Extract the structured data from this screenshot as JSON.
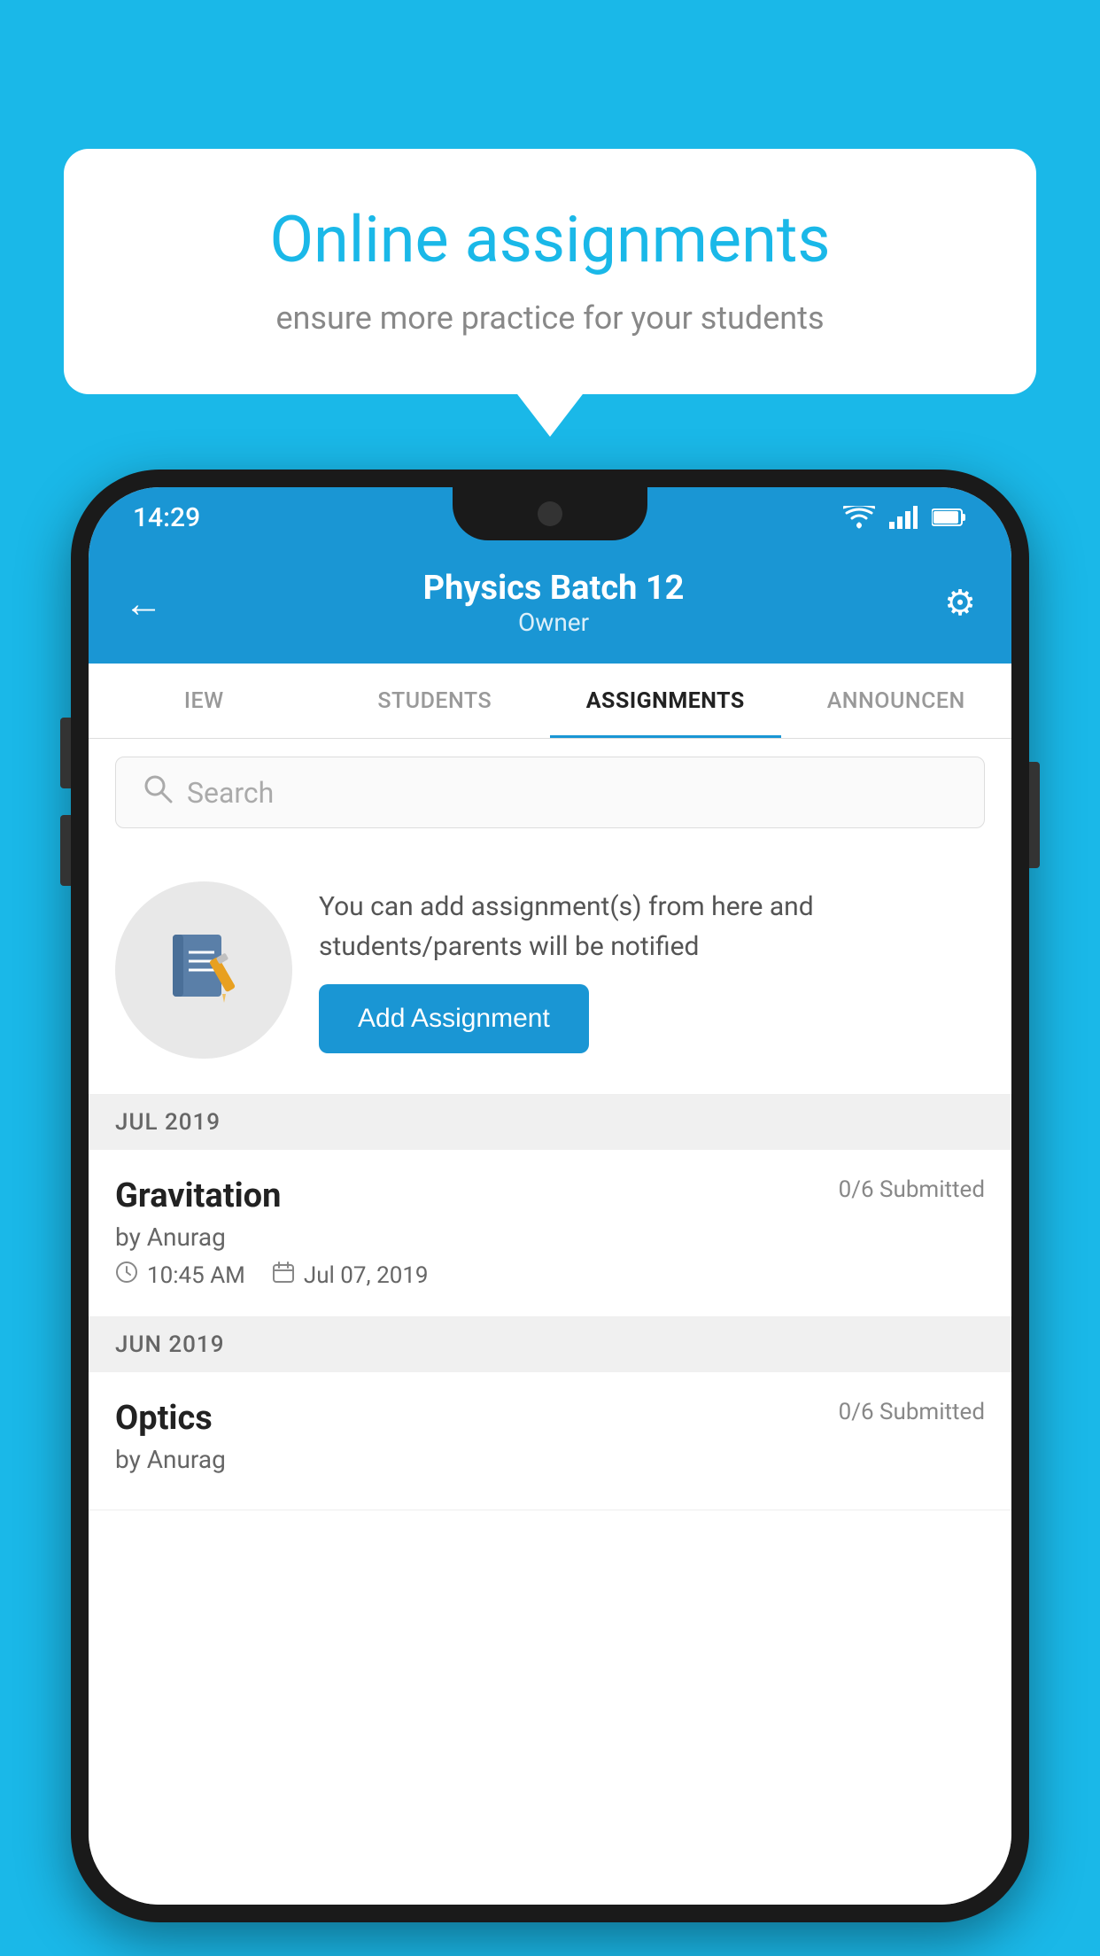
{
  "background_color": "#1ab8e8",
  "promo": {
    "title": "Online assignments",
    "subtitle": "ensure more practice for your students"
  },
  "status_bar": {
    "time": "14:29",
    "wifi": "▾",
    "signal": "▴",
    "battery": "▮"
  },
  "header": {
    "title": "Physics Batch 12",
    "subtitle": "Owner",
    "back_label": "←",
    "settings_label": "⚙"
  },
  "tabs": [
    {
      "label": "IEW",
      "active": false
    },
    {
      "label": "STUDENTS",
      "active": false
    },
    {
      "label": "ASSIGNMENTS",
      "active": true
    },
    {
      "label": "ANNOUNCEN",
      "active": false
    }
  ],
  "search": {
    "placeholder": "Search"
  },
  "add_assignment_promo": {
    "description": "You can add assignment(s) from here and students/parents will be notified",
    "button_label": "Add Assignment"
  },
  "sections": [
    {
      "header": "JUL 2019",
      "assignments": [
        {
          "name": "Gravitation",
          "submitted": "0/6 Submitted",
          "author": "by Anurag",
          "time": "10:45 AM",
          "date": "Jul 07, 2019"
        }
      ]
    },
    {
      "header": "JUN 2019",
      "assignments": [
        {
          "name": "Optics",
          "submitted": "0/6 Submitted",
          "author": "by Anurag",
          "time": "",
          "date": ""
        }
      ]
    }
  ]
}
